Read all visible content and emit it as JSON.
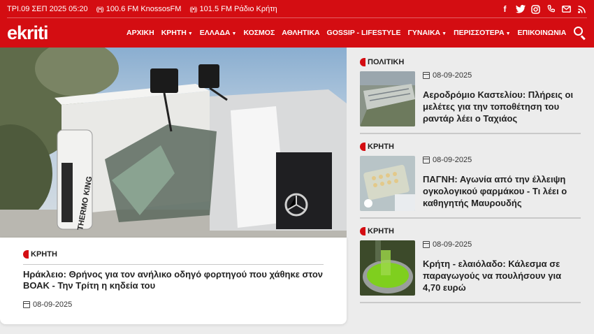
{
  "topbar": {
    "date": "ΤΡΙ.09 ΣΕΠ 2025 05:20",
    "radios": [
      {
        "label": "100.6 FM KnossosFM",
        "icon": "radio-signal-icon"
      },
      {
        "label": "101.5 FM Ράδιο Κρήτη",
        "icon": "radio-signal-icon"
      }
    ],
    "socials": [
      {
        "name": "facebook-icon",
        "glyph": "f"
      },
      {
        "name": "twitter-icon",
        "glyph": "t"
      },
      {
        "name": "instagram-icon",
        "glyph": "◎"
      },
      {
        "name": "phone-icon",
        "glyph": "✆"
      },
      {
        "name": "mail-icon",
        "glyph": "✉"
      },
      {
        "name": "rss-icon",
        "glyph": "≋"
      }
    ]
  },
  "nav": {
    "logo": "ekriti",
    "items": [
      {
        "label": "ΑΡΧΙΚΗ",
        "dropdown": false
      },
      {
        "label": "ΚΡΗΤΗ",
        "dropdown": true
      },
      {
        "label": "ΕΛΛΑΔΑ",
        "dropdown": true
      },
      {
        "label": "ΚΟΣΜΟΣ",
        "dropdown": false
      },
      {
        "label": "ΑΘΛΗΤΙΚΑ",
        "dropdown": false
      },
      {
        "label": "GOSSIP - LIFESTYLE",
        "dropdown": false
      },
      {
        "label": "ΓΥΝΑΙΚΑ",
        "dropdown": true
      },
      {
        "label": "ΠΕΡΙΣΣΟΤΕΡΑ",
        "dropdown": true
      },
      {
        "label": "ΕΠΙΚΟΙΝΩΝΙΑ",
        "dropdown": false
      }
    ],
    "caret": "▼"
  },
  "hero": {
    "category": "ΚΡΗΤΗ",
    "title": "Ηράκλειο: Θρήνος για τον ανήλικο οδηγό φορτηγού που χάθηκε στον ΒΟΑΚ - Την Τρίτη η κηδεία του",
    "date": "08-09-2025",
    "image_text": "THERMO KING"
  },
  "side": [
    {
      "category": "ΠΟΛΙΤΙΚΗ",
      "date": "08-09-2025",
      "title": "Αεροδρόμιο Καστελίου: Πλήρεις οι μελέτες για την τοποθέτηση του ραντάρ λέει ο Ταχιάος"
    },
    {
      "category": "ΚΡΗΤΗ",
      "date": "08-09-2025",
      "title": "ΠΑΓΝΗ: Αγωνία από την έλλειψη ογκολογικού φαρμάκου - Τι λέει ο καθηγητής Μαυρουδής"
    },
    {
      "category": "ΚΡΗΤΗ",
      "date": "08-09-2025",
      "title": "Κρήτη - ελαιόλαδο: Κάλεσμα σε παραγωγούς να πουλήσουν για 4,70 ευρώ"
    }
  ],
  "colors": {
    "brand": "#d40d12",
    "background": "#ececec"
  }
}
